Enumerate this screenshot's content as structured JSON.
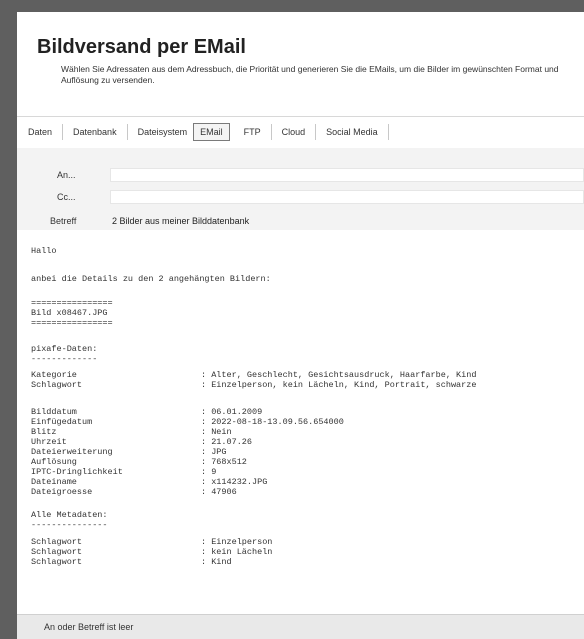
{
  "header": {
    "title": "Bildversand per EMail",
    "subtitle": "Wählen Sie Adressaten aus dem Adressbuch, die Priorität und generieren Sie die EMails, um die Bilder im gewünschten Format und Auflösung zu versenden."
  },
  "tabs": [
    "Daten",
    "Datenbank",
    "Dateisystem",
    "EMail",
    "FTP",
    "Cloud",
    "Social Media"
  ],
  "active_tab": "EMail",
  "fields": {
    "an_label": "An...",
    "an_value": "",
    "cc_label": "Cc...",
    "cc_value": "",
    "betreff_label": "Betreff",
    "betreff_value": "2 Bilder aus meiner Bilddatenbank"
  },
  "body_lines": {
    "greeting": "Hallo",
    "intro": "anbei die Details zu den 2 angehängten Bildern:",
    "sep1": "================",
    "bild": "Bild x08467.JPG",
    "sep2": "================",
    "pixafe": "pixafe-Daten:",
    "dash1": "-------------"
  },
  "details": [
    {
      "key": "Kategorie",
      "value": ": Alter, Geschlecht, Gesichtsausdruck, Haarfarbe, Kind"
    },
    {
      "key": "Schlagwort",
      "value": ": Einzelperson, kein Lächeln, Kind, Portrait, schwarze"
    },
    {
      "key": "",
      "value": ""
    },
    {
      "key": "Bilddatum",
      "value": ": 06.01.2009"
    },
    {
      "key": "Einfügedatum",
      "value": ": 2022-08-18-13.09.56.654000"
    },
    {
      "key": "Blitz",
      "value": ": Nein"
    },
    {
      "key": "Uhrzeit",
      "value": ": 21.07.26"
    },
    {
      "key": "Dateierweiterung",
      "value": ": JPG"
    },
    {
      "key": "Auflösung",
      "value": ": 768x512"
    },
    {
      "key": "IPTC-Dringlichkeit",
      "value": ": 9"
    },
    {
      "key": "Dateiname",
      "value": ": x114232.JPG"
    },
    {
      "key": "Dateigroesse",
      "value": ": 47906"
    }
  ],
  "meta": {
    "heading": "Alle Metadaten:",
    "dash": "---------------",
    "rows": [
      {
        "key": "Schlagwort",
        "value": ": Einzelperson"
      },
      {
        "key": "Schlagwort",
        "value": ": kein Lächeln"
      },
      {
        "key": "Schlagwort",
        "value": ": Kind"
      }
    ]
  },
  "status": "An oder Betreff ist leer"
}
